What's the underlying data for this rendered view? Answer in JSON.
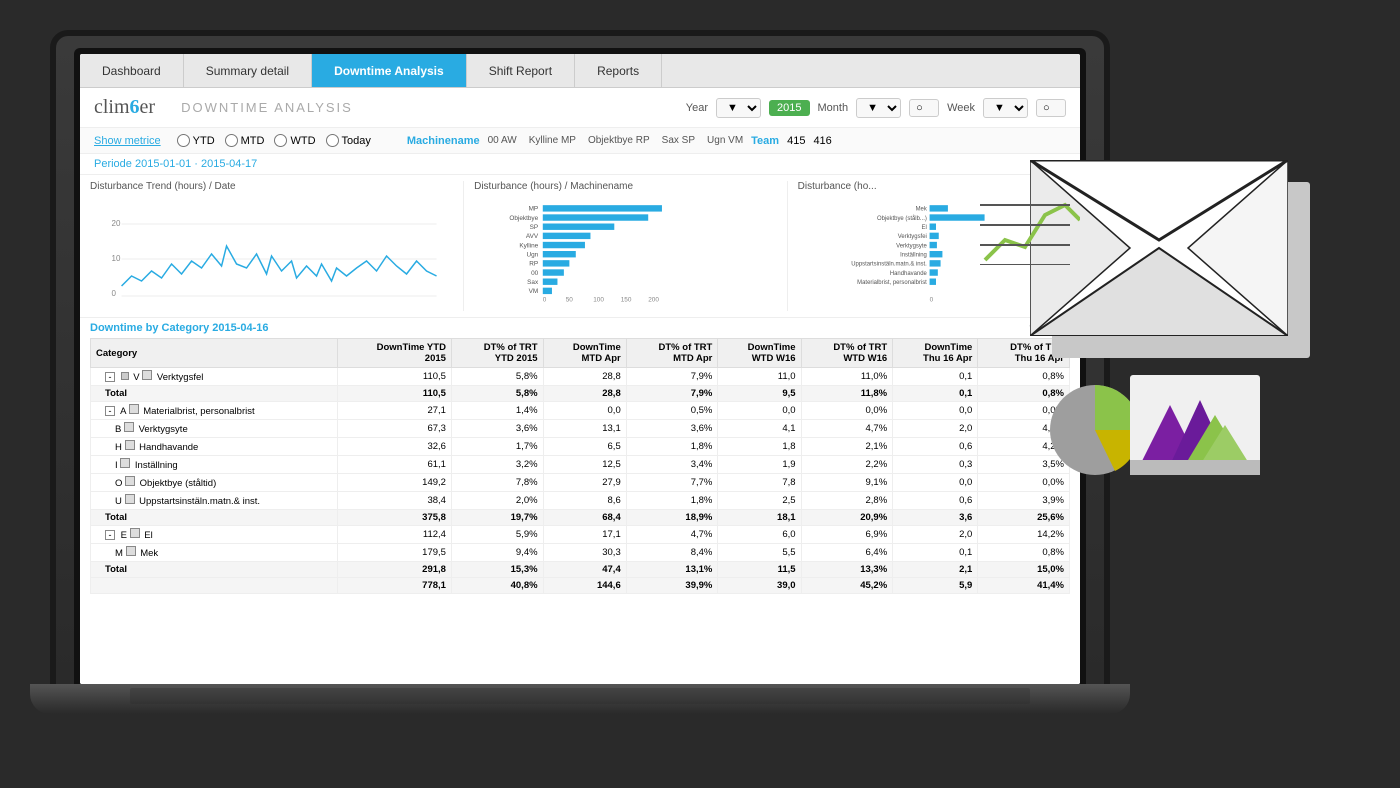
{
  "nav": {
    "tabs": [
      {
        "id": "dashboard",
        "label": "Dashboard",
        "active": false
      },
      {
        "id": "summary",
        "label": "Summary detail",
        "active": false
      },
      {
        "id": "downtime",
        "label": "Downtime Analysis",
        "active": true
      },
      {
        "id": "shift",
        "label": "Shift Report",
        "active": false
      },
      {
        "id": "reports",
        "label": "Reports",
        "active": false
      }
    ]
  },
  "header": {
    "logo": "clim6er",
    "page_title": "DOWNTIME ANALYSIS",
    "filters": {
      "year_label": "Year",
      "year_value": "2015",
      "month_label": "Month",
      "week_label": "Week"
    }
  },
  "metrics": {
    "show_label": "Show metrice",
    "radios": [
      "YTD",
      "MTD",
      "WTD",
      "Today"
    ],
    "machinename_label": "Machinename",
    "machines": [
      "00 AW",
      "Kylline MP",
      "Objektbye RP",
      "Sax SP",
      "Ugn VM"
    ],
    "team_label": "Team",
    "team_values": [
      "415",
      "416"
    ]
  },
  "period": {
    "label": "Periode 2015-01-01 · 2015-04-17"
  },
  "charts": {
    "trend_title": "Disturbance Trend (hours) / Date",
    "machine_title": "Disturbance (hours) / Machinename",
    "machine_bars": [
      {
        "label": "MP",
        "value": 200
      },
      {
        "label": "Objektbye",
        "value": 180
      },
      {
        "label": "SP",
        "value": 120
      },
      {
        "label": "AVV",
        "value": 80
      },
      {
        "label": "Kylline",
        "value": 70
      },
      {
        "label": "Ugn",
        "value": 55
      },
      {
        "label": "RP",
        "value": 45
      },
      {
        "label": "00",
        "value": 35
      },
      {
        "label": "Sax",
        "value": 25
      },
      {
        "label": "VM",
        "value": 15
      }
    ],
    "machine_axis": [
      0,
      50,
      100,
      150,
      200
    ],
    "disturbance_title": "Disturbance (ho...",
    "disturbance_bars": [
      {
        "label": "Mek",
        "value": 30
      },
      {
        "label": "Objektbye (stålb...)",
        "value": 90
      },
      {
        "label": "El",
        "value": 10
      },
      {
        "label": "Verktygsfei",
        "value": 15
      },
      {
        "label": "Verktygsyte",
        "value": 12
      },
      {
        "label": "Inställning",
        "value": 20
      },
      {
        "label": "Uppstartsinstäln.matn.& inst.",
        "value": 18
      },
      {
        "label": "Handhavande",
        "value": 14
      },
      {
        "label": "Materialbrist, personalbrist",
        "value": 10
      }
    ]
  },
  "table": {
    "title": "Downtime by Category 2015-04-16",
    "icons": [
      "📋",
      "📊",
      "📈"
    ],
    "columns": [
      "Category",
      "DownTime YTD 2015",
      "DT% of TRT YTD 2015",
      "DownTime MTD Apr",
      "DT% of TRT MTD Apr",
      "DownTime WTD W16",
      "DT% of TRT WTD W16",
      "DownTime Thu 16 Apr",
      "DT% of TRT Thu 16 Apr"
    ],
    "rows": [
      {
        "type": "group",
        "expand": "-",
        "cat_code": "V",
        "icon": true,
        "name": "Verktygsfel",
        "values": [
          "110,5",
          "5,8%",
          "28,8",
          "7,9%",
          "11,0",
          "11,0%",
          "0,1",
          "0,8%"
        ],
        "bold": false
      },
      {
        "type": "total",
        "name": "Total",
        "values": [
          "110,5",
          "5,8%",
          "28,8",
          "7,9%",
          "9,5",
          "11,8%",
          "0,1",
          "0,8%"
        ],
        "bold": true
      },
      {
        "type": "group",
        "expand": "-",
        "cat_code": "A",
        "icon": true,
        "name": "Materialbrist, personalbrist",
        "values": [
          "27,1",
          "1,4%",
          "0,0",
          "0,5%",
          "0,0",
          "0,0%",
          "0,0",
          "0,0%"
        ],
        "bold": false
      },
      {
        "type": "subrow",
        "cat_code": "B",
        "icon": true,
        "name": "Verktygsyte",
        "values": [
          "67,3",
          "3,6%",
          "13,1",
          "3,6%",
          "4,1",
          "4,7%",
          "2,0",
          "4,2%"
        ],
        "bold": false
      },
      {
        "type": "subrow",
        "cat_code": "H",
        "icon": true,
        "name": "Handhavande",
        "values": [
          "32,6",
          "1,7%",
          "6,5",
          "1,8%",
          "1,8",
          "2,1%",
          "0,6",
          "4,2%"
        ],
        "bold": false
      },
      {
        "type": "subrow",
        "cat_code": "I",
        "icon": true,
        "name": "Inställning",
        "values": [
          "61,1",
          "3,2%",
          "12,5",
          "3,4%",
          "1,9",
          "2,2%",
          "0,3",
          "3,5%"
        ],
        "bold": false
      },
      {
        "type": "subrow",
        "cat_code": "O",
        "icon": true,
        "name": "Objektbye (ståltid)",
        "values": [
          "149,2",
          "7,8%",
          "27,9",
          "7,7%",
          "7,8",
          "9,1%",
          "0,0",
          "0,0%"
        ],
        "bold": false
      },
      {
        "type": "subrow",
        "cat_code": "U",
        "icon": true,
        "name": "Uppstartsinstäln.matn.& inst.",
        "values": [
          "38,4",
          "2,0%",
          "8,6",
          "1,8%",
          "2,5",
          "2,8%",
          "0,6",
          "3,9%"
        ],
        "bold": false
      },
      {
        "type": "total",
        "name": "Total",
        "values": [
          "375,8",
          "19,7%",
          "68,4",
          "18,9%",
          "18,1",
          "20,9%",
          "3,6",
          "25,6%"
        ],
        "bold": true
      },
      {
        "type": "group",
        "expand": "-",
        "cat_code": "E",
        "icon": true,
        "name": "El",
        "values": [
          "112,4",
          "5,9%",
          "17,1",
          "4,7%",
          "6,0",
          "6,9%",
          "2,0",
          "14,2%"
        ],
        "bold": false
      },
      {
        "type": "subrow",
        "cat_code": "M",
        "icon": true,
        "name": "Mek",
        "values": [
          "179,5",
          "9,4%",
          "30,3",
          "8,4%",
          "5,5",
          "6,4%",
          "0,1",
          "0,8%"
        ],
        "bold": false
      },
      {
        "type": "total",
        "name": "Total",
        "values": [
          "291,8",
          "15,3%",
          "47,4",
          "13,1%",
          "11,5",
          "13,3%",
          "2,1",
          "15,0%"
        ],
        "bold": true
      },
      {
        "type": "grand-total",
        "name": "",
        "values": [
          "778,1",
          "40,8%",
          "144,6",
          "39,9%",
          "39,0",
          "45,2%",
          "5,9",
          "41,4%"
        ],
        "bold": true
      }
    ]
  }
}
